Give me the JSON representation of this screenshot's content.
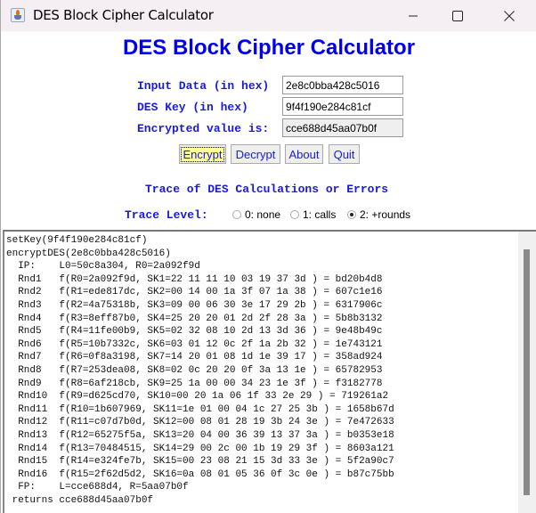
{
  "window": {
    "title": "DES Block Cipher Calculator",
    "controls": {
      "minimize": "minimize-icon",
      "maximize": "maximize-icon",
      "close": "close-icon"
    }
  },
  "header": {
    "title": "DES Block Cipher Calculator"
  },
  "form": {
    "input_label": "Input Data (in hex)",
    "input_value": "2e8c0bba428c5016",
    "key_label": "DES Key (in hex)",
    "key_value": "9f4f190e284c81cf",
    "output_label": "Encrypted value is:",
    "output_value": "cce688d45aa07b0f"
  },
  "buttons": {
    "encrypt": "Encrypt",
    "decrypt": "Decrypt",
    "about": "About",
    "quit": "Quit"
  },
  "trace": {
    "heading": "Trace of DES Calculations or Errors",
    "level_label": "Trace Level:",
    "levels": [
      {
        "label": "0: none",
        "selected": false
      },
      {
        "label": "1: calls",
        "selected": false
      },
      {
        "label": "2: +rounds",
        "selected": true
      }
    ],
    "lines": [
      "setKey(9f4f190e284c81cf)",
      "encryptDES(2e8c0bba428c5016)",
      "  IP:    L0=50c8a304, R0=2a092f9d",
      "  Rnd1   f(R0=2a092f9d, SK1=22 11 11 10 03 19 37 3d ) = bd20b4d8",
      "  Rnd2   f(R1=ede817dc, SK2=00 14 00 1a 3f 07 1a 38 ) = 607c1e16",
      "  Rnd3   f(R2=4a75318b, SK3=09 00 06 30 3e 17 29 2b ) = 6317906c",
      "  Rnd4   f(R3=8eff87b0, SK4=25 20 20 01 2d 2f 28 3a ) = 5b8b3132",
      "  Rnd5   f(R4=11fe00b9, SK5=02 32 08 10 2d 13 3d 36 ) = 9e48b49c",
      "  Rnd6   f(R5=10b7332c, SK6=03 01 12 0c 2f 1a 2b 32 ) = 1e743121",
      "  Rnd7   f(R6=0f8a3198, SK7=14 20 01 08 1d 1e 39 17 ) = 358ad924",
      "  Rnd8   f(R7=253dea08, SK8=02 0c 20 20 0f 3a 13 1e ) = 65782953",
      "  Rnd9   f(R8=6af218cb, SK9=25 1a 00 00 34 23 1e 3f ) = f3182778",
      "  Rnd10  f(R9=d625cd70, SK10=00 20 1a 06 1f 33 2e 29 ) = 719261a2",
      "  Rnd11  f(R10=1b607969, SK11=1e 01 00 04 1c 27 25 3b ) = 1658b67d",
      "  Rnd12  f(R11=c07d7b0d, SK12=00 08 01 28 19 3b 24 3e ) = 7e472633",
      "  Rnd13  f(R12=65275f5a, SK13=20 04 00 36 39 13 37 3a ) = b0353e18",
      "  Rnd14  f(R13=70484515, SK14=29 00 2c 00 1b 19 29 3f ) = 8603a121",
      "  Rnd15  f(R14=e324fe7b, SK15=00 23 08 21 15 3d 33 3e ) = 5f2a90c7",
      "  Rnd16  f(R15=2f62d5d2, SK16=0a 08 01 05 36 0f 3c 0e ) = b87c75bb",
      "  FP:    L=cce688d4, R=5aa07b0f",
      " returns cce688d45aa07b0f"
    ]
  }
}
